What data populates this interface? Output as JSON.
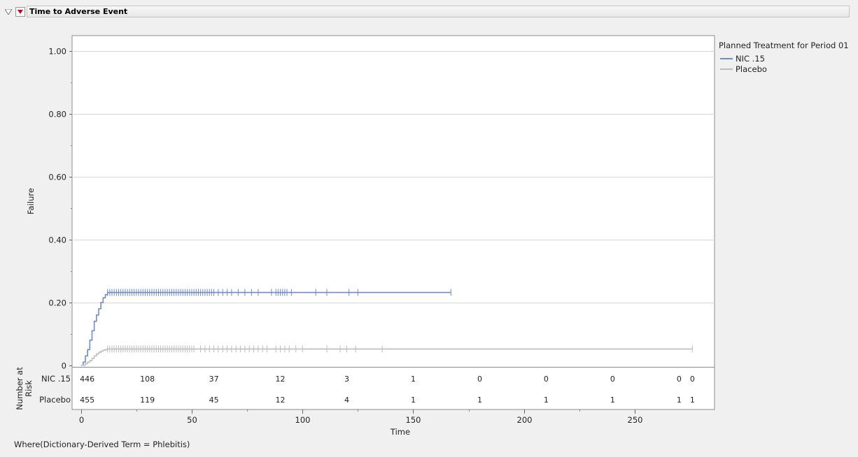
{
  "header": {
    "title": "Time to Adverse Event"
  },
  "legend": {
    "title": "Planned Treatment for Period 01",
    "items": [
      {
        "label": "NIC .15",
        "color": "#6f8cc8"
      },
      {
        "label": "Placebo",
        "color": "#bdbdbd"
      }
    ]
  },
  "footnote": "Where(Dictionary-Derived Term = Phlebitis)",
  "chart_data": {
    "type": "line",
    "xlabel": "Time",
    "ylabel": "Failure",
    "xlim": [
      -4,
      286
    ],
    "ylim": [
      -0.005,
      1.05
    ],
    "x_ticks": [
      0,
      50,
      100,
      150,
      200,
      250
    ],
    "x_tick_labels": [
      "0",
      "50",
      "100",
      "150",
      "200",
      "250"
    ],
    "y_ticks": [
      0,
      0.2,
      0.4,
      0.6,
      0.8,
      1.0
    ],
    "y_tick_labels": [
      "0",
      "0.20",
      "0.40",
      "0.60",
      "0.80",
      "1.00"
    ],
    "grid": "horizontal",
    "legend_position": "right",
    "series": [
      {
        "name": "NIC .15",
        "color": "#6f8cc8",
        "step_x": [
          0,
          1,
          2,
          3,
          4,
          5,
          6,
          7,
          8,
          9,
          10,
          11,
          12,
          167
        ],
        "step_y": [
          0,
          0.01,
          0.03,
          0.05,
          0.08,
          0.11,
          0.14,
          0.16,
          0.18,
          0.2,
          0.215,
          0.225,
          0.232,
          0.232
        ],
        "censor_x": [
          12,
          13,
          14,
          15,
          16,
          17,
          18,
          19,
          20,
          21,
          22,
          23,
          24,
          25,
          26,
          27,
          28,
          29,
          30,
          31,
          32,
          33,
          34,
          35,
          36,
          37,
          38,
          39,
          40,
          41,
          42,
          43,
          44,
          45,
          46,
          47,
          48,
          49,
          50,
          51,
          52,
          53,
          54,
          55,
          56,
          57,
          58,
          59,
          60,
          62,
          64,
          66,
          68,
          71,
          74,
          77,
          80,
          86,
          88,
          89,
          90,
          91,
          92,
          93,
          95,
          106,
          111,
          121,
          125,
          167
        ],
        "censor_y": 0.232
      },
      {
        "name": "Placebo",
        "color": "#bdbdbd",
        "step_x": [
          0,
          2,
          3,
          4,
          5,
          6,
          7,
          8,
          9,
          10,
          11,
          12,
          276
        ],
        "step_y": [
          0,
          0.005,
          0.01,
          0.015,
          0.022,
          0.03,
          0.036,
          0.041,
          0.045,
          0.048,
          0.05,
          0.052,
          0.052
        ],
        "censor_x": [
          12,
          13,
          14,
          15,
          16,
          17,
          18,
          19,
          20,
          21,
          22,
          23,
          24,
          25,
          26,
          27,
          28,
          29,
          30,
          31,
          32,
          33,
          34,
          35,
          36,
          37,
          38,
          39,
          40,
          41,
          42,
          43,
          44,
          45,
          46,
          47,
          48,
          49,
          50,
          51,
          54,
          56,
          58,
          60,
          62,
          64,
          66,
          68,
          70,
          72,
          74,
          76,
          78,
          80,
          82,
          84,
          88,
          90,
          92,
          94,
          97,
          100,
          111,
          117,
          120,
          124,
          136,
          276
        ],
        "censor_y": 0.052
      }
    ],
    "at_risk": {
      "label": "Number at Risk",
      "times": [
        0,
        30,
        60,
        90,
        120,
        150,
        180,
        210,
        240,
        270,
        276
      ],
      "rows": [
        {
          "name": "NIC .15",
          "counts": [
            "446",
            "108",
            "37",
            "12",
            "3",
            "1",
            "0",
            "0",
            "0",
            "0",
            "0"
          ]
        },
        {
          "name": "Placebo",
          "counts": [
            "455",
            "119",
            "45",
            "12",
            "4",
            "1",
            "1",
            "1",
            "1",
            "1",
            "1"
          ]
        }
      ]
    }
  }
}
